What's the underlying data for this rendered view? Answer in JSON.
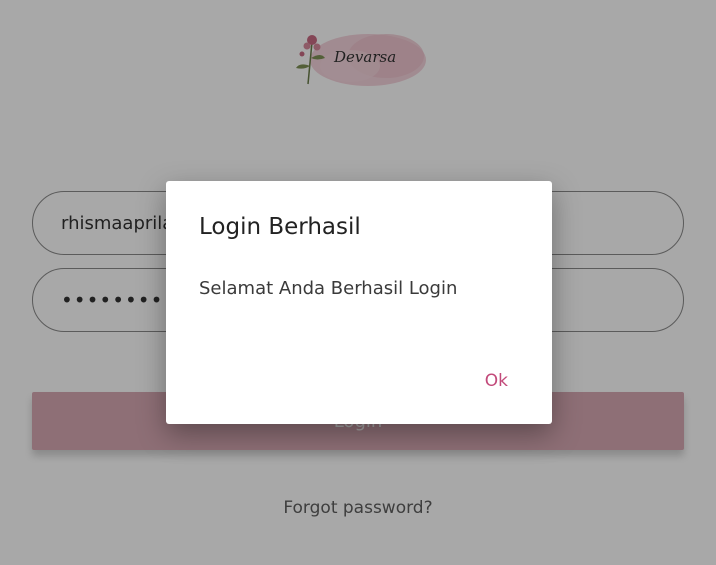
{
  "logo": {
    "script_text": "Devarsa"
  },
  "form": {
    "username_value": "rhismaaprilaaaaaaaaaaaaaaa",
    "password_value": "••••••••••••••••••••••••••••••",
    "login_label": "Login"
  },
  "links": {
    "forgot_password": "Forgot password?"
  },
  "dialog": {
    "title": "Login Berhasil",
    "message": "Selamat Anda Berhasil Login",
    "ok_label": "Ok"
  },
  "colors": {
    "accent": "#c2497a",
    "button_bg": "#d8a9b4",
    "input_border": "#8a8a8a"
  }
}
